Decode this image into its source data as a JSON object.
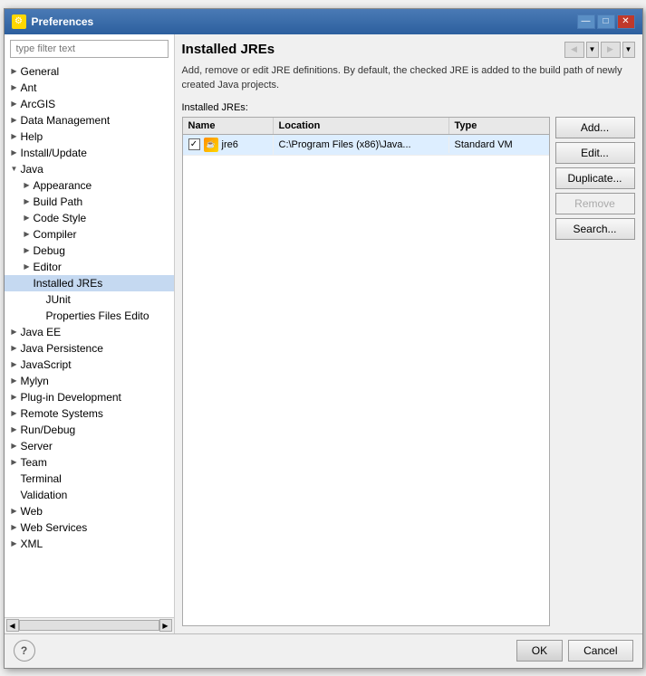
{
  "window": {
    "title": "Preferences",
    "icon": "⚙"
  },
  "filter": {
    "placeholder": "type filter text"
  },
  "tree": {
    "items": [
      {
        "id": "general",
        "label": "General",
        "level": 0,
        "hasArrow": true,
        "arrowDir": "right",
        "selected": false
      },
      {
        "id": "ant",
        "label": "Ant",
        "level": 0,
        "hasArrow": true,
        "arrowDir": "right",
        "selected": false
      },
      {
        "id": "arcgis",
        "label": "ArcGIS",
        "level": 0,
        "hasArrow": true,
        "arrowDir": "right",
        "selected": false
      },
      {
        "id": "data-management",
        "label": "Data Management",
        "level": 0,
        "hasArrow": true,
        "arrowDir": "right",
        "selected": false
      },
      {
        "id": "help",
        "label": "Help",
        "level": 0,
        "hasArrow": true,
        "arrowDir": "right",
        "selected": false
      },
      {
        "id": "install-update",
        "label": "Install/Update",
        "level": 0,
        "hasArrow": true,
        "arrowDir": "right",
        "selected": false
      },
      {
        "id": "java",
        "label": "Java",
        "level": 0,
        "hasArrow": true,
        "arrowDir": "down",
        "selected": false
      },
      {
        "id": "appearance",
        "label": "Appearance",
        "level": 1,
        "hasArrow": true,
        "arrowDir": "right",
        "selected": false
      },
      {
        "id": "build-path",
        "label": "Build Path",
        "level": 1,
        "hasArrow": true,
        "arrowDir": "right",
        "selected": false
      },
      {
        "id": "code-style",
        "label": "Code Style",
        "level": 1,
        "hasArrow": true,
        "arrowDir": "right",
        "selected": false
      },
      {
        "id": "compiler",
        "label": "Compiler",
        "level": 1,
        "hasArrow": true,
        "arrowDir": "right",
        "selected": false
      },
      {
        "id": "debug",
        "label": "Debug",
        "level": 1,
        "hasArrow": true,
        "arrowDir": "right",
        "selected": false
      },
      {
        "id": "editor",
        "label": "Editor",
        "level": 1,
        "hasArrow": true,
        "arrowDir": "right",
        "selected": false
      },
      {
        "id": "installed-jres",
        "label": "Installed JREs",
        "level": 1,
        "hasArrow": false,
        "arrowDir": "",
        "selected": true
      },
      {
        "id": "junit",
        "label": "JUnit",
        "level": 2,
        "hasArrow": false,
        "arrowDir": "",
        "selected": false
      },
      {
        "id": "properties-files-editor",
        "label": "Properties Files Edito",
        "level": 2,
        "hasArrow": false,
        "arrowDir": "",
        "selected": false
      },
      {
        "id": "java-ee",
        "label": "Java EE",
        "level": 0,
        "hasArrow": true,
        "arrowDir": "right",
        "selected": false
      },
      {
        "id": "java-persistence",
        "label": "Java Persistence",
        "level": 0,
        "hasArrow": true,
        "arrowDir": "right",
        "selected": false
      },
      {
        "id": "javascript",
        "label": "JavaScript",
        "level": 0,
        "hasArrow": true,
        "arrowDir": "right",
        "selected": false
      },
      {
        "id": "mylyn",
        "label": "Mylyn",
        "level": 0,
        "hasArrow": true,
        "arrowDir": "right",
        "selected": false
      },
      {
        "id": "plug-in-development",
        "label": "Plug-in Development",
        "level": 0,
        "hasArrow": true,
        "arrowDir": "right",
        "selected": false
      },
      {
        "id": "remote-systems",
        "label": "Remote Systems",
        "level": 0,
        "hasArrow": true,
        "arrowDir": "right",
        "selected": false
      },
      {
        "id": "run-debug",
        "label": "Run/Debug",
        "level": 0,
        "hasArrow": true,
        "arrowDir": "right",
        "selected": false
      },
      {
        "id": "server",
        "label": "Server",
        "level": 0,
        "hasArrow": true,
        "arrowDir": "right",
        "selected": false
      },
      {
        "id": "team",
        "label": "Team",
        "level": 0,
        "hasArrow": true,
        "arrowDir": "right",
        "selected": false
      },
      {
        "id": "terminal",
        "label": "Terminal",
        "level": 0,
        "hasArrow": false,
        "arrowDir": "",
        "selected": false
      },
      {
        "id": "validation",
        "label": "Validation",
        "level": 0,
        "hasArrow": false,
        "arrowDir": "",
        "selected": false
      },
      {
        "id": "web",
        "label": "Web",
        "level": 0,
        "hasArrow": true,
        "arrowDir": "right",
        "selected": false
      },
      {
        "id": "web-services",
        "label": "Web Services",
        "level": 0,
        "hasArrow": true,
        "arrowDir": "right",
        "selected": false
      },
      {
        "id": "xml",
        "label": "XML",
        "level": 0,
        "hasArrow": true,
        "arrowDir": "right",
        "selected": false
      }
    ]
  },
  "main": {
    "title": "Installed JREs",
    "description": "Add, remove or edit JRE definitions. By default, the checked JRE is added to the build path of newly created Java projects.",
    "installed_label": "Installed JREs:",
    "columns": [
      "Name",
      "Location",
      "Type"
    ],
    "rows": [
      {
        "checked": true,
        "name": "jre6",
        "location": "C:\\Program Files (x86)\\Java...",
        "type": "Standard VM"
      }
    ]
  },
  "buttons": {
    "add": "Add...",
    "edit": "Edit...",
    "duplicate": "Duplicate...",
    "remove": "Remove",
    "search": "Search..."
  },
  "footer": {
    "help_label": "?",
    "ok_label": "OK",
    "cancel_label": "Cancel"
  },
  "nav": {
    "back_arrow": "◀",
    "forward_arrow": "▶",
    "dropdown": "▼"
  }
}
